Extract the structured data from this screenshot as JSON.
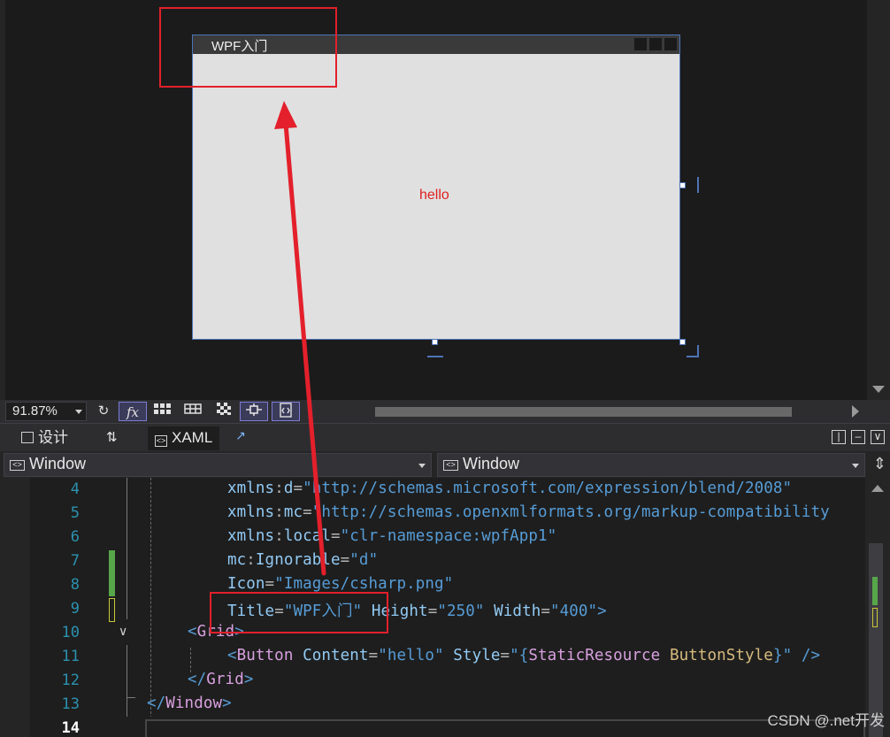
{
  "designer": {
    "window_title": "WPF入门",
    "button_content": "hello"
  },
  "zoom_toolbar": {
    "zoom_level": "91.87%",
    "fx_label": "fx"
  },
  "tabs": {
    "design_label": "设计",
    "swap_label": "⇅",
    "xaml_label": "XAML"
  },
  "nav": {
    "left_value": "Window",
    "right_value": "Window"
  },
  "editor": {
    "lines": [
      {
        "num": "4"
      },
      {
        "num": "5"
      },
      {
        "num": "6"
      },
      {
        "num": "7"
      },
      {
        "num": "8"
      },
      {
        "num": "9"
      },
      {
        "num": "10"
      },
      {
        "num": "11"
      },
      {
        "num": "12"
      },
      {
        "num": "13"
      },
      {
        "num": "14"
      }
    ],
    "tokens": {
      "xmlns": "xmlns",
      "colon": ":",
      "eq": "=",
      "d": "d",
      "d_val": "\"http://schemas.microsoft.com/expression/blend/2008\"",
      "mc": "mc",
      "mc_val": "\"http://schemas.openxmlformats.org/markup-compatibility",
      "local": "local",
      "local_val": "\"clr-namespace:wpfApp1\"",
      "ignorable": "Ignorable",
      "ignorable_val": "\"d\"",
      "icon": "Icon",
      "icon_val": "\"Images/csharp.png\"",
      "title": "Title",
      "title_val": "\"WPF入门\"",
      "height": "Height",
      "height_val": "\"250\"",
      "width": "Width",
      "width_val": "\"400\"",
      "gt": ">",
      "lt": "<",
      "lt_slash": "</",
      "slash_gt": " />",
      "grid": "Grid",
      "button": "Button",
      "content": "Content",
      "content_val": "\"hello\"",
      "style": "Style",
      "style_open": "\"{",
      "static_res": "StaticResource",
      "button_style": "ButtonStyle",
      "style_close": "}\"",
      "window": "Window"
    }
  },
  "watermark": "CSDN @.net开发",
  "colors": {
    "annotation_red": "#e3202b",
    "selection_blue": "#4d74b6",
    "attr_name": "#92caf4",
    "attr_value": "#569cd6",
    "tag_name": "#d8a0df",
    "hello_text": "#e02020"
  }
}
